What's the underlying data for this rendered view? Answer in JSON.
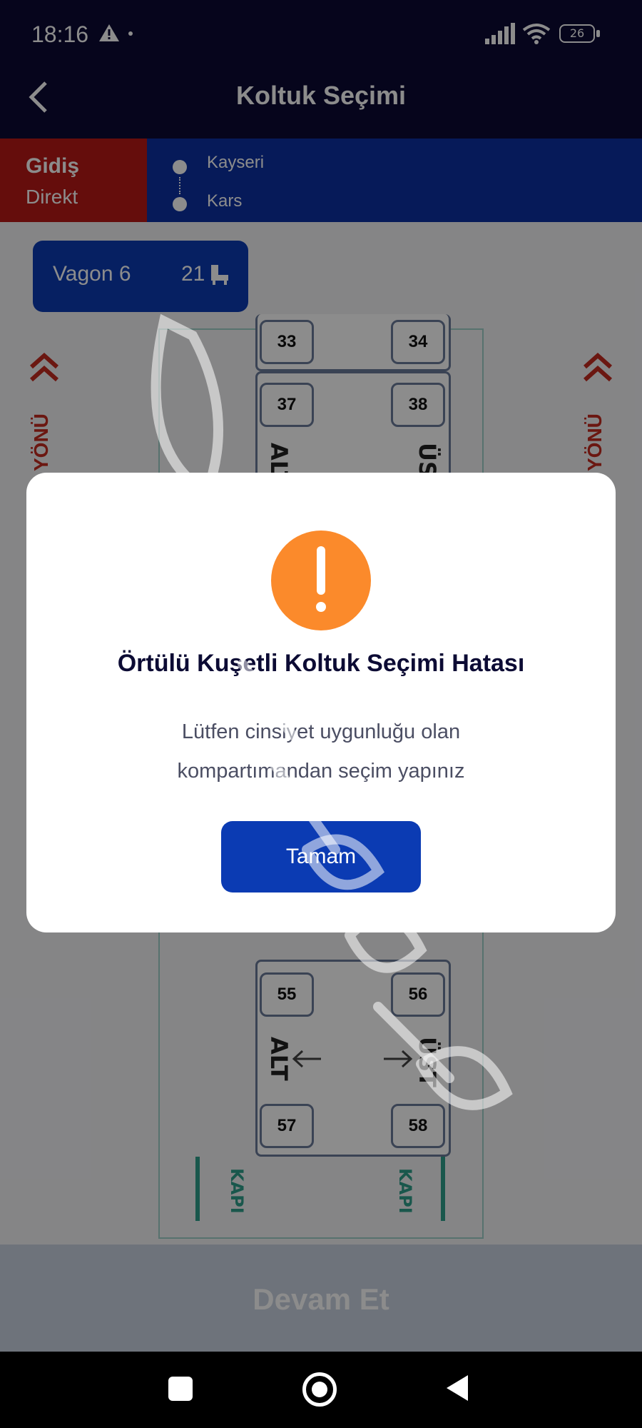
{
  "status_bar": {
    "time": "18:16",
    "battery": "26"
  },
  "header": {
    "title": "Koltuk Seçimi"
  },
  "route": {
    "direction": "Gidiş",
    "direction_type": "Direkt",
    "from": "Kayseri",
    "to": "Kars"
  },
  "wagon": {
    "label": "Vagon 6",
    "available": "21"
  },
  "seat_map": {
    "direction_text": "YÖNÜ",
    "compartments": [
      {
        "seats": [
          "33",
          "34"
        ]
      },
      {
        "seats": [
          "37",
          "38"
        ],
        "lower": "ALT",
        "upper": "ÜST"
      },
      {
        "seats": [
          "55",
          "56",
          "57",
          "58"
        ],
        "lower": "ALT",
        "upper": "ÜST"
      }
    ],
    "door_label": "KAPI"
  },
  "footer": {
    "continue_label": "Devam Et"
  },
  "dialog": {
    "title": "Örtülü Kuşetli Koltuk Seçimi Hatası",
    "message_line1": "Lütfen cinsiyet uygunluğu olan",
    "message_line2": "kompartımandan seçim yapınız",
    "ok_label": "Tamam"
  },
  "watermark": "sikayetvar",
  "colors": {
    "primary": "#0b3bb3",
    "header_bg": "#0b0a33",
    "direction_red": "#b81817",
    "alert_orange": "#fb8a2b"
  }
}
